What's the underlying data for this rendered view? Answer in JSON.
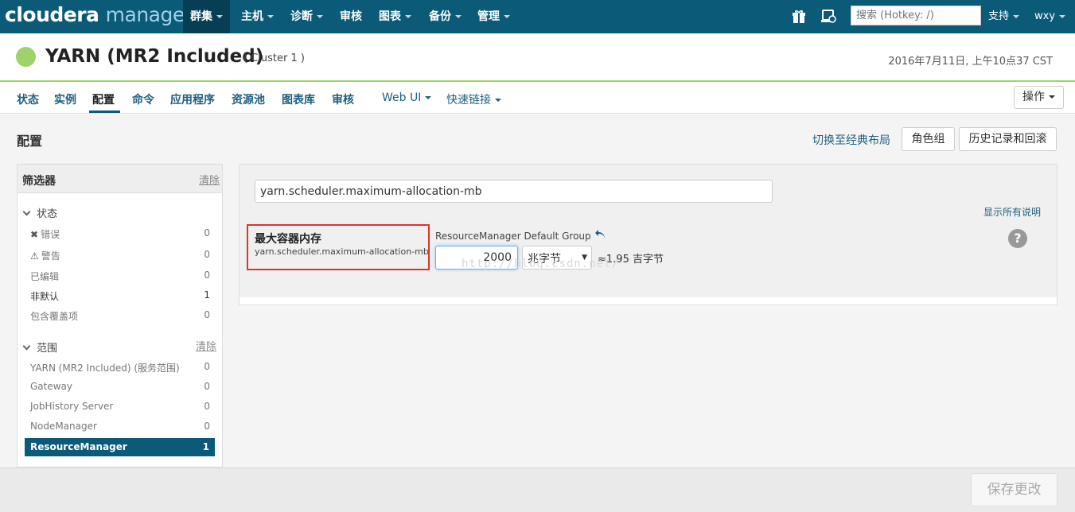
{
  "topbar": {
    "logo_part1": "cloudera",
    "logo_part2": "manager",
    "nav": [
      "群集",
      "主机",
      "诊断",
      "审核",
      "图表",
      "备份",
      "管理"
    ],
    "search_placeholder": "搜索 (Hotkey: /)",
    "support": "支持",
    "user": "wxy"
  },
  "header": {
    "title": "YARN (MR2 Included)",
    "cluster": "( Cluster 1 )",
    "datestamp": "2016年7月11日, 上午10点37 CST"
  },
  "tabs": [
    "状态",
    "实例",
    "配置",
    "命令",
    "应用程序",
    "资源池",
    "图表库",
    "审核",
    "Web UI",
    "快速链接"
  ],
  "actions_label": "操作",
  "section": {
    "title": "配置",
    "switch_classic": "切换至经典布局",
    "role_groups": "角色组",
    "history": "历史记录和回滚"
  },
  "sidebar": {
    "title": "筛选器",
    "clear": "清除",
    "status_group": "状态",
    "status_items": [
      {
        "label": "错误",
        "count": "0"
      },
      {
        "label": "警告",
        "count": "0"
      },
      {
        "label": "已编辑",
        "count": "0"
      },
      {
        "label": "非默认",
        "count": "1"
      },
      {
        "label": "包含覆盖项",
        "count": "0"
      }
    ],
    "scope_group": "范围",
    "scope_clear": "清除",
    "scope_items": [
      {
        "label": "YARN (MR2 Included) (服务范围)",
        "count": "0"
      },
      {
        "label": "Gateway",
        "count": "0"
      },
      {
        "label": "JobHistory Server",
        "count": "0"
      },
      {
        "label": "NodeManager",
        "count": "0"
      },
      {
        "label": "ResourceManager",
        "count": "1"
      }
    ]
  },
  "config": {
    "search_value": "yarn.scheduler.maximum-allocation-mb",
    "show_descriptions": "显示所有说明",
    "prop_title": "最大容器内存",
    "prop_key": "yarn.scheduler.maximum-allocation-mb",
    "group_label": "ResourceManager Default Group",
    "value": "2000",
    "unit": "兆字节",
    "approx": "≈1.95 吉字节",
    "help": "?",
    "watermark": "http://blog.csdn.net/"
  },
  "footer": {
    "save": "保存更改"
  }
}
